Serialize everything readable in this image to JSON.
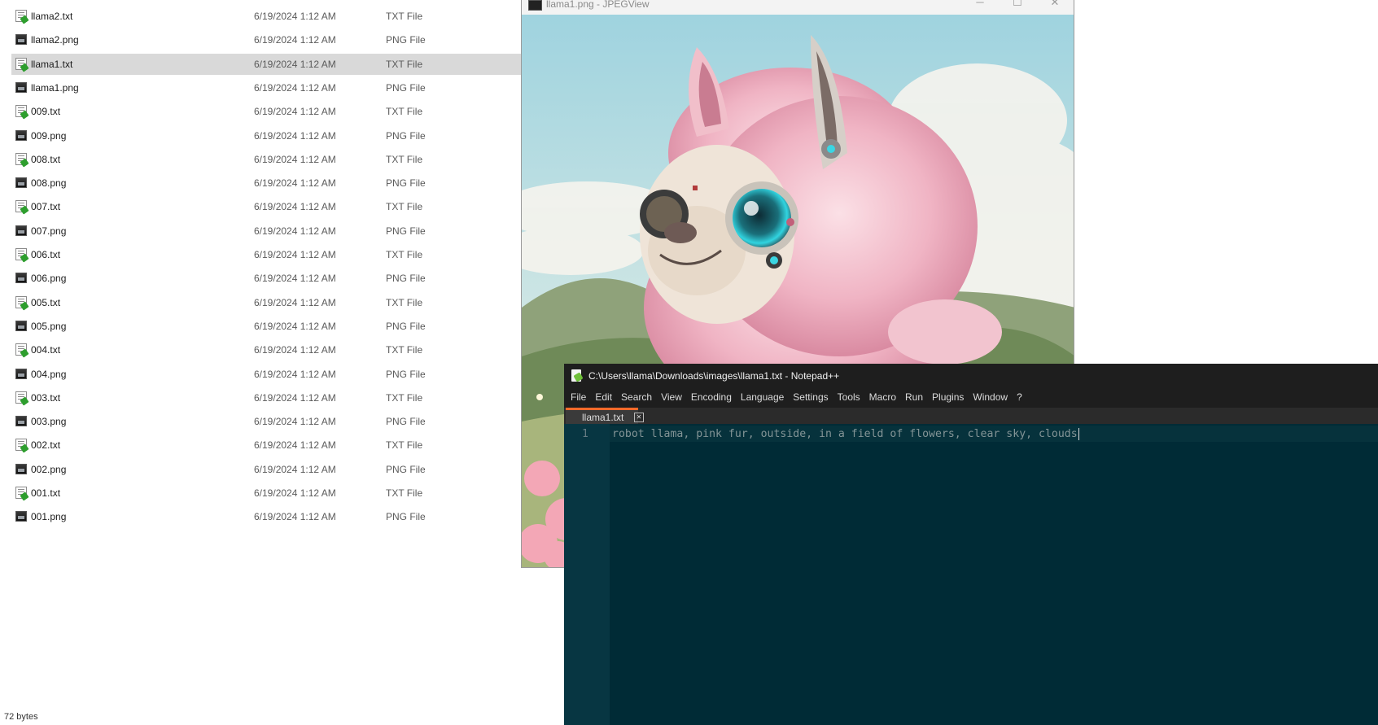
{
  "explorer": {
    "files": [
      {
        "name": "llama2.txt",
        "date": "6/19/2024 1:12 AM",
        "type": "TXT File",
        "kind": "txt",
        "selected": false
      },
      {
        "name": "llama2.png",
        "date": "6/19/2024 1:12 AM",
        "type": "PNG File",
        "kind": "png",
        "selected": false
      },
      {
        "name": "llama1.txt",
        "date": "6/19/2024 1:12 AM",
        "type": "TXT File",
        "kind": "txt",
        "selected": true
      },
      {
        "name": "llama1.png",
        "date": "6/19/2024 1:12 AM",
        "type": "PNG File",
        "kind": "png",
        "selected": false
      },
      {
        "name": "009.txt",
        "date": "6/19/2024 1:12 AM",
        "type": "TXT File",
        "kind": "txt",
        "selected": false
      },
      {
        "name": "009.png",
        "date": "6/19/2024 1:12 AM",
        "type": "PNG File",
        "kind": "png",
        "selected": false
      },
      {
        "name": "008.txt",
        "date": "6/19/2024 1:12 AM",
        "type": "TXT File",
        "kind": "txt",
        "selected": false
      },
      {
        "name": "008.png",
        "date": "6/19/2024 1:12 AM",
        "type": "PNG File",
        "kind": "png",
        "selected": false
      },
      {
        "name": "007.txt",
        "date": "6/19/2024 1:12 AM",
        "type": "TXT File",
        "kind": "txt",
        "selected": false
      },
      {
        "name": "007.png",
        "date": "6/19/2024 1:12 AM",
        "type": "PNG File",
        "kind": "png",
        "selected": false
      },
      {
        "name": "006.txt",
        "date": "6/19/2024 1:12 AM",
        "type": "TXT File",
        "kind": "txt",
        "selected": false
      },
      {
        "name": "006.png",
        "date": "6/19/2024 1:12 AM",
        "type": "PNG File",
        "kind": "png",
        "selected": false
      },
      {
        "name": "005.txt",
        "date": "6/19/2024 1:12 AM",
        "type": "TXT File",
        "kind": "txt",
        "selected": false
      },
      {
        "name": "005.png",
        "date": "6/19/2024 1:12 AM",
        "type": "PNG File",
        "kind": "png",
        "selected": false
      },
      {
        "name": "004.txt",
        "date": "6/19/2024 1:12 AM",
        "type": "TXT File",
        "kind": "txt",
        "selected": false
      },
      {
        "name": "004.png",
        "date": "6/19/2024 1:12 AM",
        "type": "PNG File",
        "kind": "png",
        "selected": false
      },
      {
        "name": "003.txt",
        "date": "6/19/2024 1:12 AM",
        "type": "TXT File",
        "kind": "txt",
        "selected": false
      },
      {
        "name": "003.png",
        "date": "6/19/2024 1:12 AM",
        "type": "PNG File",
        "kind": "png",
        "selected": false
      },
      {
        "name": "002.txt",
        "date": "6/19/2024 1:12 AM",
        "type": "TXT File",
        "kind": "txt",
        "selected": false
      },
      {
        "name": "002.png",
        "date": "6/19/2024 1:12 AM",
        "type": "PNG File",
        "kind": "png",
        "selected": false
      },
      {
        "name": "001.txt",
        "date": "6/19/2024 1:12 AM",
        "type": "TXT File",
        "kind": "txt",
        "selected": false
      },
      {
        "name": "001.png",
        "date": "6/19/2024 1:12 AM",
        "type": "PNG File",
        "kind": "png",
        "selected": false
      }
    ],
    "status": "72 bytes"
  },
  "jpegview": {
    "title": "llama1.png - JPEGView",
    "controls": {
      "minimize": "─",
      "maximize": "☐",
      "close": "✕"
    }
  },
  "notepad": {
    "title": "C:\\Users\\llama\\Downloads\\images\\llama1.txt - Notepad++",
    "menu": [
      "File",
      "Edit",
      "Search",
      "View",
      "Encoding",
      "Language",
      "Settings",
      "Tools",
      "Macro",
      "Run",
      "Plugins",
      "Window",
      "?"
    ],
    "tab": {
      "label": "llama1.txt",
      "close": "✕"
    },
    "line_number": "1",
    "text": "robot llama, pink fur, outside, in a field of flowers, clear sky, clouds"
  },
  "colors": {
    "selection": "#d9d9d9",
    "npp_bg": "#002b36",
    "npp_gutter": "#073642",
    "npp_text": "#839496",
    "tab_accent": "#ff6a2a",
    "llama_fur": "#f2b9c8"
  },
  "icons": {
    "txt": "text-file-icon",
    "png": "image-file-icon",
    "app": "notepadpp-icon",
    "viewer": "jpegview-icon"
  }
}
